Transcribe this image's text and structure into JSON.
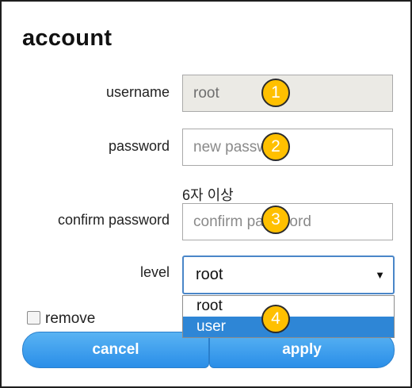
{
  "dialog": {
    "title": "account"
  },
  "form": {
    "username": {
      "label": "username",
      "value": "root"
    },
    "password": {
      "label": "password",
      "placeholder": "new password"
    },
    "hint": "6자 이상",
    "confirm": {
      "label": "confirm password",
      "placeholder": "confirm password"
    },
    "level": {
      "label": "level",
      "selected": "root",
      "options": [
        "root",
        "user"
      ],
      "highlighted": "user"
    },
    "remove": {
      "label": "remove",
      "checked": false
    }
  },
  "buttons": {
    "cancel": "cancel",
    "apply": "apply"
  },
  "annotations": [
    "1",
    "2",
    "3",
    "4"
  ],
  "colors": {
    "accent": "#2e86d6",
    "badge": "#ffc000"
  }
}
